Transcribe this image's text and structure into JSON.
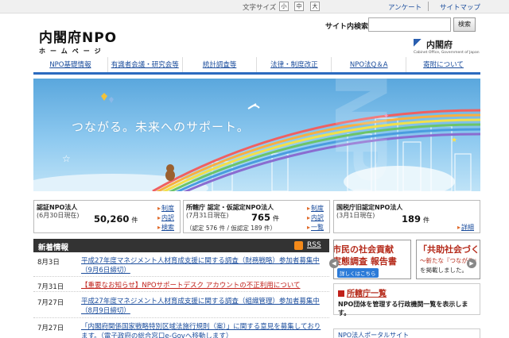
{
  "util": {
    "font_size_label": "文字サイズ",
    "font_sizes": [
      "小",
      "中",
      "大"
    ],
    "links": [
      "アンケート",
      "サイトマップ"
    ]
  },
  "header": {
    "logo_main": "内閣府NPO",
    "logo_sub": "ホームページ",
    "search_label": "サイト内検索",
    "search_placeholder": "",
    "search_button": "検索",
    "cao_name": "内閣府",
    "cao_en": "Cabinet Office, Government of Japan"
  },
  "nav": [
    "NPO基礎情報",
    "有識者会議・研究会等",
    "統計調査等",
    "法律・制度改正",
    "NPO法Q＆A",
    "寄附について"
  ],
  "hero": {
    "catch": "つながる。未来へのサポート。",
    "big_text": "NPO"
  },
  "stats": [
    {
      "title": "認証NPO法人",
      "date": "(6月30日現在)",
      "number": "50,260",
      "unit": "件",
      "links": [
        "制度",
        "内訳",
        "検索"
      ]
    },
    {
      "title": "所轄庁 認定・仮認定NPO法人",
      "date": "(7月31日現在)",
      "number": "765",
      "unit": "件",
      "detail": "（認定 576 件 / 仮認定 189 件）",
      "links": [
        "制度",
        "内訳",
        "一覧"
      ]
    },
    {
      "title": "国税庁旧認定NPO法人",
      "date": "(3月1日現在)",
      "number": "189",
      "unit": "件",
      "links": [
        "詳細"
      ]
    }
  ],
  "news": {
    "title": "新着情報",
    "rss": "RSS",
    "items": [
      {
        "date": "8月3日",
        "text": "平成27年度マネジメント人材育成支援に関する調査（財務戦略）参加者募集中（9月6日締切）",
        "warn": false
      },
      {
        "date": "7月31日",
        "text": "【重要なお知らせ】NPOサポートデスク アカウントの不正利用について",
        "warn": true
      },
      {
        "date": "7月27日",
        "text": "平成27年度マネジメント人材育成支援に関する調査（組織管理）参加者募集中（8月9日締切）",
        "warn": false
      },
      {
        "date": "7月27日",
        "text": "「内閣府関係国家戦略特別区域法施行規則（案）」に関する意見を募集しております。（電子政府の総合窓口e-Govへ移動します）",
        "warn": false
      }
    ]
  },
  "banners": {
    "b1_line1": "市民の社会貢献",
    "b1_line2": "実態調査 報告書",
    "b1_chip": "詳しくはこちら",
    "b2_line1": "「共助社会づく",
    "b2_small": "～新たな『つながり』",
    "b2_small2": "を掲載しました。"
  },
  "ministry": {
    "title": "所轄庁一覧",
    "desc": "NPO団体を管理する行政機関一覧を表示します。"
  },
  "bottom_box": {
    "title": "NPO法人ポータルサイト"
  },
  "colors": {
    "accent": "#2b6bbf",
    "link": "#1a4c9c",
    "warn": "#c0201a",
    "news_header": "#333333"
  }
}
